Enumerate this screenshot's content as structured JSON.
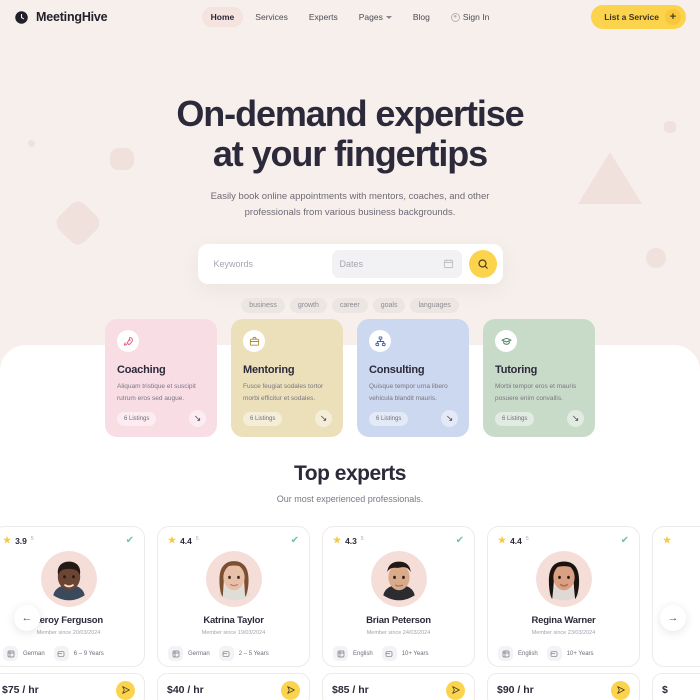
{
  "brand": {
    "name": "MeetingHive",
    "icon": "clock-icon"
  },
  "nav": {
    "items": [
      {
        "label": "Home",
        "active": true
      },
      {
        "label": "Services",
        "active": false
      },
      {
        "label": "Experts",
        "active": false
      },
      {
        "label": "Pages",
        "active": false,
        "caret": true
      },
      {
        "label": "Blog",
        "active": false
      },
      {
        "label": "Sign In",
        "active": false,
        "icon": "user-circle-icon"
      }
    ],
    "cta": {
      "label": "List a Service",
      "icon": "plus-icon",
      "color": "#fcd34d"
    }
  },
  "hero": {
    "title_line1": "On-demand expertise",
    "title_line2": "at your fingertips",
    "subtitle_line1": "Easily book online appointments with mentors, coaches, and other",
    "subtitle_line2": "professionals from various business backgrounds."
  },
  "search": {
    "keywords_placeholder": "Keywords",
    "dates_placeholder": "Dates",
    "calendar_icon": "calendar-icon",
    "submit_icon": "search-icon",
    "submit_color": "#fcd34d"
  },
  "tags": [
    "business",
    "growth",
    "career",
    "goals",
    "languages"
  ],
  "services": [
    {
      "title": "Coaching",
      "desc": "Aliquam tristique et suscipit rutrum eros sed augue.",
      "listings": "6 Listings",
      "icon": "rocket-icon",
      "bg": "#f9dde5"
    },
    {
      "title": "Mentoring",
      "desc": "Fusce feugiat sodales tortor morbi efficitur et sodales.",
      "listings": "6 Listings",
      "icon": "briefcase-icon",
      "bg": "#ece0bb"
    },
    {
      "title": "Consulting",
      "desc": "Quisque tempor urna libero vehicula blandit mauris.",
      "listings": "6 Listings",
      "icon": "sitemap-icon",
      "bg": "#ccd8ef"
    },
    {
      "title": "Tutoring",
      "desc": "Morbi tempor eros et mauris posuere enim convallis.",
      "listings": "6 Listings",
      "icon": "graduation-cap-icon",
      "bg": "#c8dbc9"
    }
  ],
  "experts_section": {
    "title": "Top experts",
    "subtitle": "Our most experienced professionals.",
    "prev_icon": "arrow-left-icon",
    "next_icon": "arrow-right-icon"
  },
  "experts": [
    {
      "rating": "3.9",
      "rating_sup": "5",
      "verified_icon": "verified-badge-icon",
      "name": "Leroy Ferguson",
      "member_since": "Member since 20/03/2024",
      "language": "German",
      "experience": "6 – 9 Years",
      "price": "$75 / hr",
      "book_icon": "send-icon",
      "skin": "#6b4434",
      "hair": "#231a16",
      "shirt": "#3a4a5c"
    },
    {
      "rating": "4.4",
      "rating_sup": "5",
      "verified_icon": "verified-badge-icon",
      "name": "Katrina Taylor",
      "member_since": "Member since 19/03/2024",
      "language": "German",
      "experience": "2 – 5 Years",
      "price": "$40 / hr",
      "book_icon": "send-icon",
      "skin": "#e8c0a8",
      "hair": "#7b4f32",
      "shirt": "#e0ddd8"
    },
    {
      "rating": "4.3",
      "rating_sup": "5",
      "verified_icon": "verified-badge-icon",
      "name": "Brian Peterson",
      "member_since": "Member since 24/03/2024",
      "language": "English",
      "experience": "10+ Years",
      "price": "$85 / hr",
      "book_icon": "send-icon",
      "skin": "#d9ab8b",
      "hair": "#211713",
      "shirt": "#2b2b30"
    },
    {
      "rating": "4.4",
      "rating_sup": "5",
      "verified_icon": "verified-badge-icon",
      "name": "Regina Warner",
      "member_since": "Member since 23/03/2024",
      "language": "English",
      "experience": "10+ Years",
      "price": "$90 / hr",
      "book_icon": "send-icon",
      "skin": "#d9a083",
      "hair": "#1b1310",
      "shirt": "#ded9d4"
    }
  ],
  "theme": {
    "page_bg": "#f6efeb",
    "deco": "#f0e1dc",
    "accent": "#fcd34d",
    "text_dark": "#2c2a3a"
  }
}
